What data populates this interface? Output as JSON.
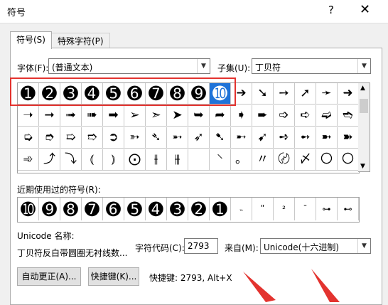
{
  "window": {
    "title": "符号",
    "help": "?",
    "close": "✕"
  },
  "tabs": [
    {
      "label": "符号(S)"
    },
    {
      "label": "特殊字符(P)"
    }
  ],
  "font": {
    "label": "字体(F):",
    "value": "(普通文本)"
  },
  "subset": {
    "label": "子集(U):",
    "value": "丁贝符"
  },
  "grid_rows": [
    [
      "➊",
      "➋",
      "➌",
      "➍",
      "➎",
      "➏",
      "➐",
      "➑",
      "➒",
      "➓",
      "➔",
      "➘",
      "➙",
      "➚",
      "➛",
      "➜"
    ],
    [
      "➝",
      "➞",
      "➟",
      "➠",
      "➡",
      "➢",
      "➣",
      "➤",
      "➥",
      "➦",
      "➧",
      "➨",
      "➩",
      "➪",
      "➫",
      "➬"
    ],
    [
      "➭",
      "➮",
      "➯",
      "➱",
      "➲",
      "➳",
      "➴",
      "➵",
      "➶",
      "➷",
      "➸",
      "➹",
      "➺",
      "➻",
      "➼",
      "➽"
    ],
    [
      "➾",
      "⤴",
      "⤵",
      "⦅",
      "⦆",
      "⨀",
      "⫲",
      "⫵",
      "",
      "⸌",
      "。",
      "〃",
      "〄",
      "〆",
      "〇",
      "〇"
    ]
  ],
  "recent": {
    "label": "近期使用过的符号(R):",
    "items": [
      "➓",
      "➒",
      "➑",
      "➐",
      "➏",
      "➎",
      "➍",
      "➌",
      "➋",
      "➊",
      "˵",
      "ʺ",
      "²",
      "¯",
      "⊶",
      "⊷"
    ]
  },
  "unicode": {
    "label": "Unicode 名称:",
    "name": "丁贝符反白带圆圈无衬线数..."
  },
  "char_code": {
    "label": "字符代码(C):",
    "value": "2793"
  },
  "from": {
    "label": "来自(M):",
    "value": "Unicode(十六进制)"
  },
  "buttons": {
    "autocorrect": "自动更正(A)...",
    "shortcut": "快捷键(K)..."
  },
  "shortcut_text": "快捷键: 2793, Alt+X",
  "selected_index": 9,
  "colors": {
    "selection": "#1f73d8",
    "highlight_box": "#e3332f"
  }
}
